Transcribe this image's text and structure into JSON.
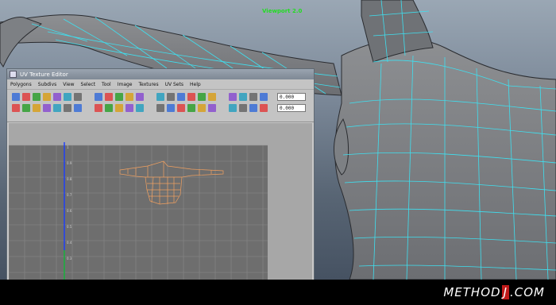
{
  "viewport": {
    "label": "Viewport 2.0"
  },
  "uv_editor": {
    "title": "UV Texture Editor",
    "menu": [
      "Polygons",
      "Subdivs",
      "View",
      "Select",
      "Tool",
      "Image",
      "Textures",
      "UV Sets",
      "Help"
    ],
    "fields": [
      "0.000",
      "0.000"
    ],
    "axis_labels": [
      "1",
      "0.9",
      "0.8",
      "0.7",
      "0.6",
      "0.5",
      "0.4",
      "0.3"
    ]
  },
  "watermark": {
    "before": "METHOD",
    "highlight": "J",
    "after": ".COM"
  },
  "icons": {
    "title_icon": "uv-editor-window-icon",
    "toolbar": "uv-tool-icons"
  },
  "colors": {
    "wireframe": "#3ee0f0",
    "uv_shell": "#f0a060",
    "axis_v": "#1a3cff",
    "axis_u": "#20c020",
    "viewport_label": "#22dd22",
    "watermark_highlight": "#c01a1a"
  }
}
